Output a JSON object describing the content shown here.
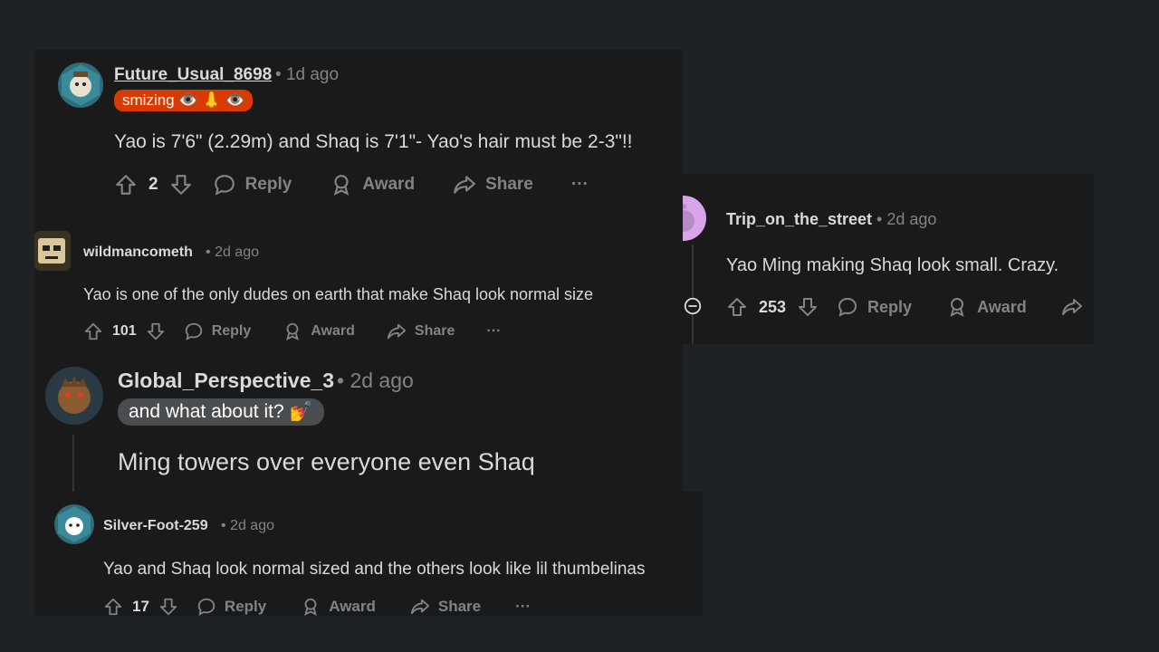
{
  "comments": [
    {
      "username": "Future_Usual_8698",
      "time": "1d ago",
      "flair": "smizing 👁️ 👃 👁️",
      "text": "Yao is 7'6\" (2.29m) and Shaq is 7'1\"- Yao's hair must be 2-3\"!!",
      "votes": "2",
      "actions": {
        "reply": "Reply",
        "award": "Award",
        "share": "Share",
        "more": "···"
      }
    },
    {
      "username": "wildmancometh",
      "time": "2d ago",
      "text": "Yao is one of the only dudes on earth that make Shaq look normal size",
      "votes": "101",
      "actions": {
        "reply": "Reply",
        "award": "Award",
        "share": "Share",
        "more": "···"
      }
    },
    {
      "username": "Global_Perspective_3",
      "time": "2d ago",
      "flair": "and what about it? 💅",
      "text": "Ming towers over everyone even Shaq"
    },
    {
      "username": "Silver-Foot-259",
      "time": "2d ago",
      "text": "Yao and Shaq look normal sized and the others look like lil thumbelinas",
      "votes": "17",
      "actions": {
        "reply": "Reply",
        "award": "Award",
        "share": "Share",
        "more": "···"
      }
    },
    {
      "username": "Trip_on_the_street",
      "time": "2d ago",
      "text": "Yao Ming making Shaq look small. Crazy.",
      "votes": "253",
      "actions": {
        "reply": "Reply",
        "award": "Award"
      }
    }
  ],
  "separator": "•",
  "colors": {
    "background": "#1e2224",
    "panel": "#1a1a1b",
    "text": "#d7dadc",
    "muted": "#818384",
    "flair_orange": "#d93a00",
    "flair_gray": "#4a4d50"
  }
}
